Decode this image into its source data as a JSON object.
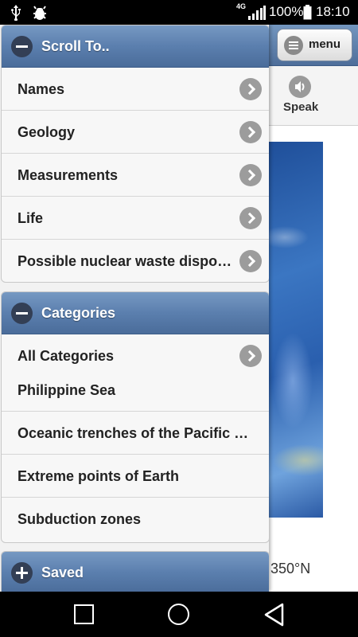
{
  "status_bar": {
    "network": "4G",
    "battery_percent": "100%",
    "time": "18:10"
  },
  "header": {
    "menu_label": "menu"
  },
  "toolbar": {
    "speak_label": "Speak"
  },
  "content": {
    "coordinate_fragment": "350°N"
  },
  "drawer": {
    "scroll_to": {
      "title": "Scroll To..",
      "items": [
        {
          "label": "Names"
        },
        {
          "label": "Geology"
        },
        {
          "label": "Measurements"
        },
        {
          "label": "Life"
        },
        {
          "label": "Possible nuclear waste disposal site"
        }
      ]
    },
    "categories": {
      "title": "Categories",
      "all_label": "All Categories",
      "current": "Philippine Sea",
      "items": [
        {
          "label": "Oceanic trenches of the Pacific Ocean"
        },
        {
          "label": "Extreme points of Earth"
        },
        {
          "label": "Subduction zones"
        }
      ]
    },
    "saved": {
      "title": "Saved"
    }
  },
  "icons": {
    "usb": "usb-icon",
    "bug": "bug-icon",
    "signal": "signal-icon",
    "battery": "battery-icon",
    "collapse": "minus-circle-icon",
    "expand": "plus-circle-icon",
    "chevron": "chevron-right-icon",
    "menu": "hamburger-icon",
    "speak": "speaker-icon"
  },
  "colors": {
    "panel_header": "#5b7fae",
    "status_bar": "#000000"
  }
}
